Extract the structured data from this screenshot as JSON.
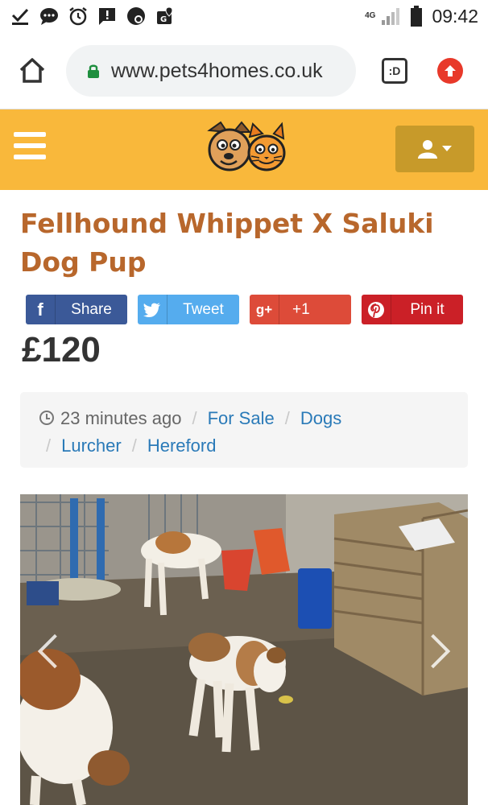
{
  "status_bar": {
    "time": "09:42",
    "network": "4G",
    "icons": [
      "download-done-icon",
      "chat-icon",
      "alarm-icon",
      "alert-message-icon",
      "app-notification-icon",
      "location-settings-icon",
      "signal-icon",
      "battery-icon"
    ]
  },
  "browser": {
    "url": "www.pets4homes.co.uk",
    "tabs_label": ":D"
  },
  "listing": {
    "title": "Fellhound Whippet X Saluki Dog Pup",
    "price": "£120",
    "posted": "23 minutes ago",
    "breadcrumbs": [
      "For Sale",
      "Dogs",
      "Lurcher",
      "Hereford"
    ]
  },
  "share": {
    "facebook": "Share",
    "twitter": "Tweet",
    "google": "+1",
    "google_icon": "g+",
    "pinterest": "Pin it"
  },
  "colors": {
    "header": "#f9b83b",
    "title": "#b8672c",
    "link": "#2a7ab8",
    "facebook": "#3b5998",
    "twitter": "#55acee",
    "google": "#dd4b39",
    "pinterest": "#cb2027"
  }
}
